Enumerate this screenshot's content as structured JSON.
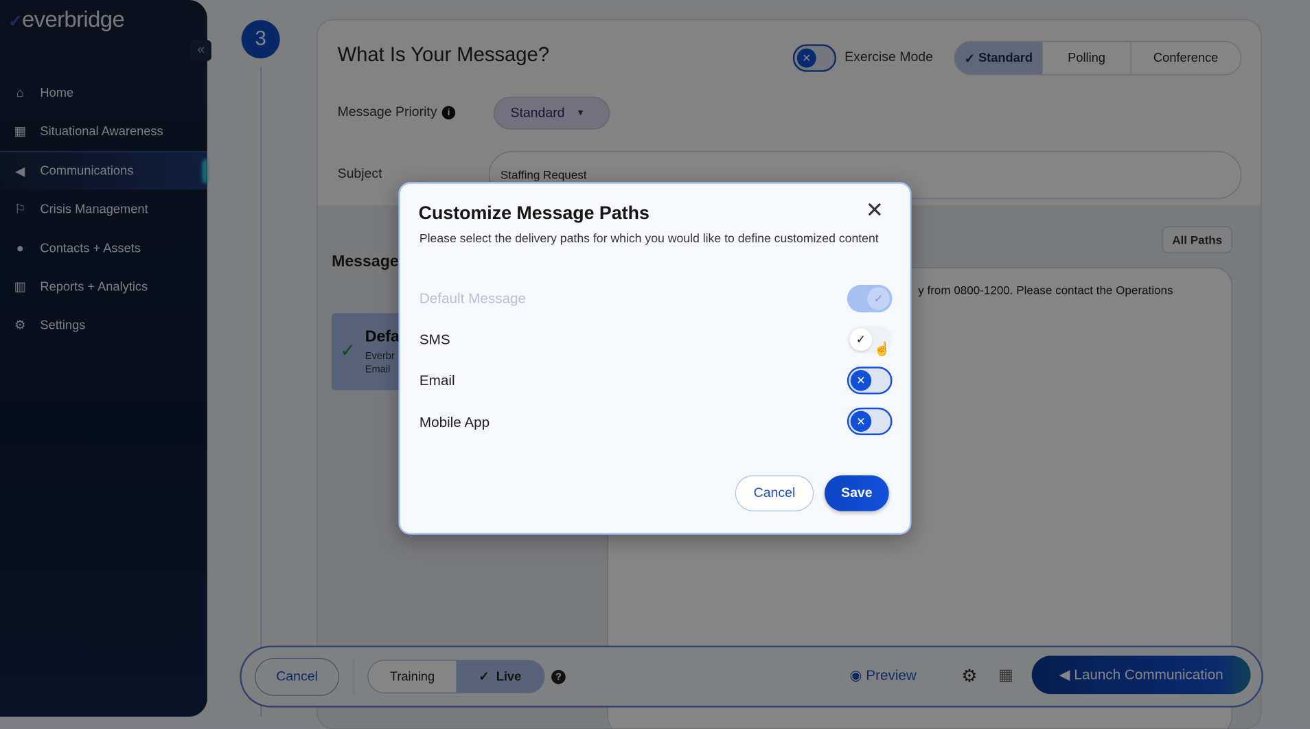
{
  "sidebar": {
    "logo": "everbridge",
    "collapse_icon": "double-chevron-left",
    "items": [
      {
        "label": "Home",
        "icon": "home"
      },
      {
        "label": "Situational Awareness",
        "icon": "map"
      },
      {
        "label": "Communications",
        "icon": "megaphone",
        "active": true
      },
      {
        "label": "Crisis Management",
        "icon": "crisis"
      },
      {
        "label": "Contacts + Assets",
        "icon": "map-pin"
      },
      {
        "label": "Reports + Analytics",
        "icon": "bar-chart"
      },
      {
        "label": "Settings",
        "icon": "gear"
      }
    ]
  },
  "step": {
    "number": "3"
  },
  "form": {
    "title": "What Is Your Message?",
    "exercise_mode": {
      "label": "Exercise Mode",
      "enabled": false
    },
    "type_tabs": [
      {
        "label": "Standard",
        "selected": true
      },
      {
        "label": "Polling",
        "selected": false
      },
      {
        "label": "Conference",
        "selected": false
      }
    ],
    "priority": {
      "label": "Message Priority",
      "value": "Standard"
    },
    "subject": {
      "label": "Subject",
      "value": "Staffing Request"
    },
    "message_heading": "Message",
    "all_paths_label": "All Paths",
    "body_excerpt": "y from 0800-1200. Please contact the Operations",
    "default_card": {
      "title": "Defa",
      "line1": "Everbr",
      "line2": "Email"
    }
  },
  "bottom_bar": {
    "cancel": "Cancel",
    "mode_tabs": [
      {
        "label": "Training",
        "selected": false
      },
      {
        "label": "Live",
        "selected": true
      }
    ],
    "preview": "Preview",
    "launch": "Launch Communication"
  },
  "modal": {
    "title": "Customize Message Paths",
    "description": "Please select the delivery paths for which you would like to define customized content",
    "paths": [
      {
        "label": "Default Message",
        "enabled": true,
        "disabled": true
      },
      {
        "label": "SMS",
        "enabled": true,
        "disabled": false
      },
      {
        "label": "Email",
        "enabled": false,
        "disabled": false
      },
      {
        "label": "Mobile App",
        "enabled": false,
        "disabled": false
      }
    ],
    "cancel": "Cancel",
    "save": "Save"
  },
  "colors": {
    "primary": "#1150d9",
    "sidebar": "#0e1a33",
    "accent": "#2fd6e8"
  }
}
